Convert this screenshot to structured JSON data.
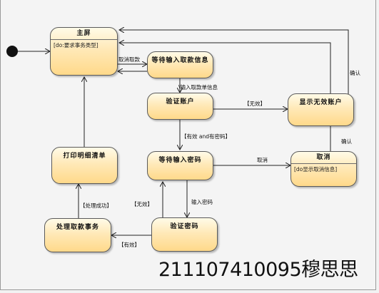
{
  "states": {
    "main": {
      "title": "主屏",
      "activity": "[do:要求事务类型]"
    },
    "wait_amount": {
      "title": "等待输入取款信息"
    },
    "verify_account": {
      "title": "验证账户"
    },
    "invalid_account": {
      "title": "显示无效账户"
    },
    "wait_password": {
      "title": "等待输入密码"
    },
    "cancel": {
      "title": "取消",
      "activity": "[do显示取消信息]"
    },
    "verify_password": {
      "title": "验证密码"
    },
    "process": {
      "title": "处理取款事务"
    },
    "print": {
      "title": "打印明细清单"
    }
  },
  "labels": {
    "cancel_withdraw": "取消取款",
    "input_amount": "\\输入取款单信息",
    "invalid": "【无效】",
    "valid_password": "【有效 and有密码】",
    "confirm_top": "确认",
    "confirm_cancel": "确认",
    "cancel_edge": "取消",
    "input_password": "输入密码",
    "invalid_pw": "【无效】",
    "valid_pw": "【有效】",
    "process_success": "【处理成功】"
  },
  "watermark": "211107410095穆思思"
}
